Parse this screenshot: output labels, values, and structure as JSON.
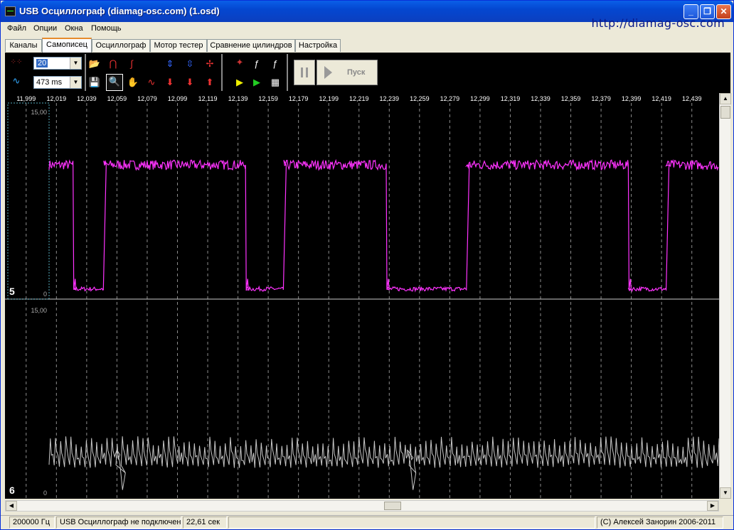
{
  "window": {
    "title": "USB Осциллограф (diamag-osc.com) (1.osd)",
    "url_label": "http://diamag-osc.com"
  },
  "menu": [
    "Файл",
    "Опции",
    "Окна",
    "Помощь"
  ],
  "tabs": [
    "Каналы",
    "Самописец",
    "Осциллограф",
    "Мотор тестер",
    "Сравнение цилиндров",
    "Настройка"
  ],
  "active_tab": "Самописец",
  "toolbar": {
    "scale_value": "20",
    "time_value": "473 ms",
    "run_label": "Пуск"
  },
  "time_axis_labels": [
    "11,999",
    "12,019",
    "12,039",
    "12,059",
    "12,079",
    "12,099",
    "12,119",
    "12,139",
    "12,159",
    "12,179",
    "12,199",
    "12,219",
    "12,239",
    "12,259",
    "12,279",
    "12,299",
    "12,319",
    "12,339",
    "12,359",
    "12,379",
    "12,399",
    "12,419",
    "12,439"
  ],
  "channels": [
    {
      "number": "5",
      "max_label": "15,00",
      "min_label": "0",
      "color": "#ff33ff"
    },
    {
      "number": "6",
      "max_label": "15,00",
      "min_label": "0",
      "color": "#c8c8c8"
    }
  ],
  "chart_data": {
    "type": "line",
    "x_ticks": [
      11.999,
      12.019,
      12.039,
      12.059,
      12.079,
      12.099,
      12.119,
      12.139,
      12.159,
      12.179,
      12.199,
      12.219,
      12.239,
      12.259,
      12.279,
      12.299,
      12.319,
      12.339,
      12.359,
      12.379,
      12.399,
      12.419,
      12.439
    ],
    "xlim": [
      11.985,
      12.457
    ],
    "ylim": [
      0,
      15
    ],
    "series": [
      {
        "channel": "5",
        "kind": "square",
        "high": 10.6,
        "low": 0.3,
        "transitions": [
          {
            "t": 12.03,
            "level": "low"
          },
          {
            "t": 12.05,
            "level": "high"
          },
          {
            "t": 12.144,
            "level": "low"
          },
          {
            "t": 12.169,
            "level": "high"
          },
          {
            "t": 12.237,
            "level": "low"
          },
          {
            "t": 12.29,
            "level": "high"
          },
          {
            "t": 12.397,
            "level": "low"
          },
          {
            "t": 12.422,
            "level": "high"
          }
        ],
        "initial_level": "high"
      },
      {
        "channel": "6",
        "kind": "sawtooth",
        "amplitude_range": [
          2.0,
          4.6
        ],
        "period": 0.0034,
        "glitches": [
          12.058,
          12.25
        ]
      }
    ]
  },
  "status": {
    "frequency": "200000  Гц",
    "connection": "USB Осциллограф не подключен",
    "duration": "22,61 сек",
    "copyright": "(C) Алексей Занорин 2006-2011"
  }
}
